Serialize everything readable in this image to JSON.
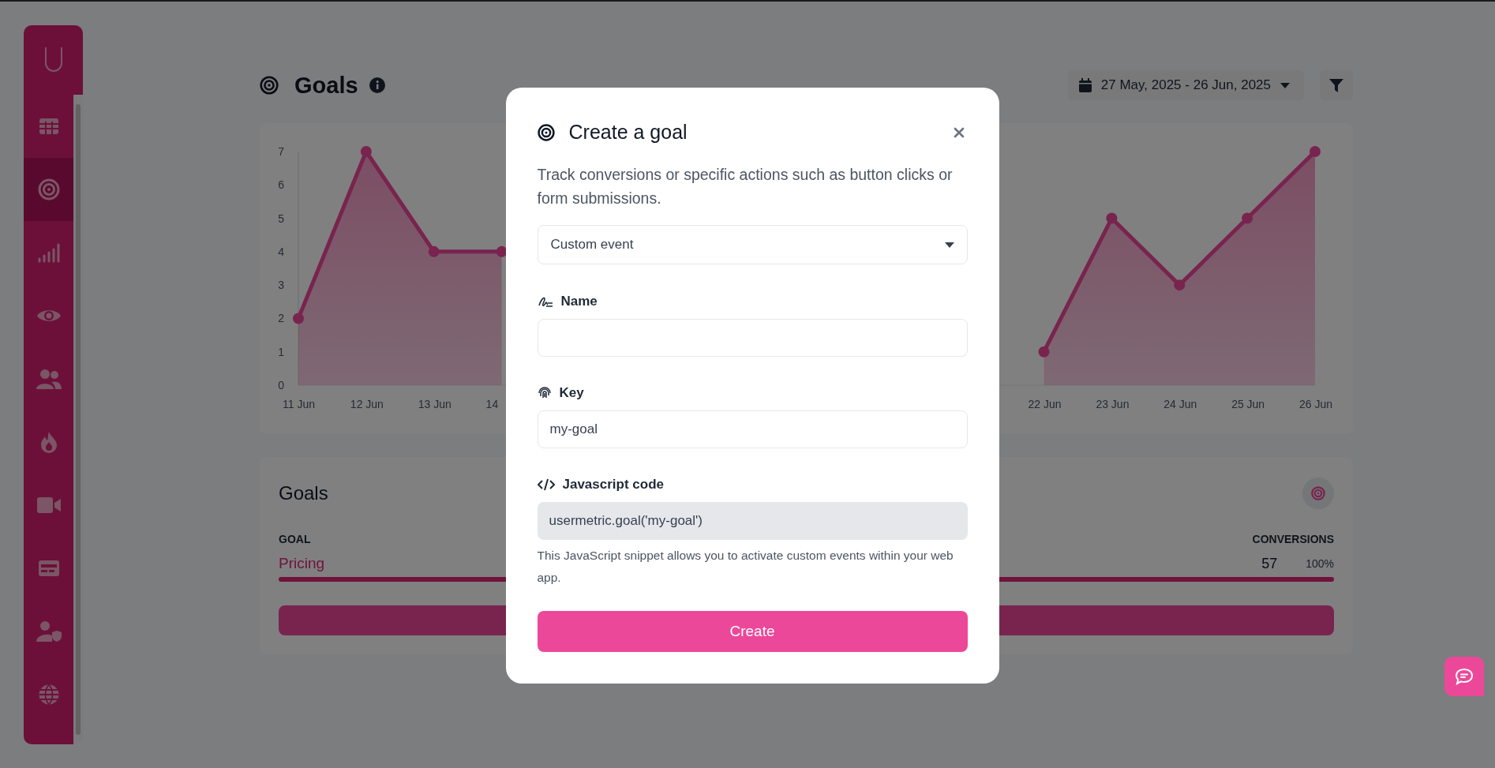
{
  "sidebar": {
    "items": [
      {
        "kind": "table",
        "selected": false
      },
      {
        "kind": "target",
        "selected": true
      },
      {
        "kind": "signal",
        "selected": false
      },
      {
        "kind": "eye",
        "selected": false
      },
      {
        "kind": "users",
        "selected": false
      },
      {
        "kind": "fire",
        "selected": false
      },
      {
        "kind": "video",
        "selected": false
      },
      {
        "kind": "card",
        "selected": false
      },
      {
        "kind": "user-shield",
        "selected": false
      },
      {
        "kind": "globe",
        "selected": false
      }
    ]
  },
  "header": {
    "title": "Goals",
    "date_range": "27 May, 2025 - 26 Jun, 2025"
  },
  "chart": {
    "chart_data": {
      "type": "area",
      "categories": [
        "11 Jun",
        "12 Jun",
        "13 Jun",
        "14",
        null,
        null,
        null,
        null,
        null,
        null,
        null,
        "22 Jun",
        "23 Jun",
        "24 Jun",
        "25 Jun",
        "26 Jun"
      ],
      "ylim": [
        0,
        7
      ],
      "yticks": [
        0,
        1,
        2,
        3,
        4,
        5,
        6,
        7
      ],
      "series": [
        {
          "color": "#ec4899",
          "values": [
            2,
            7,
            4,
            4,
            null,
            null,
            null,
            null,
            null,
            null,
            null,
            1,
            5,
            3,
            5,
            7
          ]
        }
      ]
    }
  },
  "goals_card": {
    "title": "Goals",
    "columns": [
      "GOAL",
      "CONVERSIONS"
    ],
    "rows": [
      {
        "goal": "Pricing",
        "conversions": "57",
        "percent": "100%",
        "level": 1
      }
    ]
  },
  "modal": {
    "title": "Create a goal",
    "description": "Track conversions or specific actions such as button clicks or form submissions.",
    "event_type": "Custom event",
    "fields": [
      {
        "kind": "name",
        "label": "Name"
      },
      {
        "kind": "key",
        "label": "Key",
        "value": "my-goal"
      },
      {
        "kind": "code",
        "label": "Javascript code",
        "value": "usermetric.goal('my-goal')",
        "note": "This JavaScript snippet allows you to activate custom events within your web app."
      }
    ],
    "button": "Create"
  }
}
